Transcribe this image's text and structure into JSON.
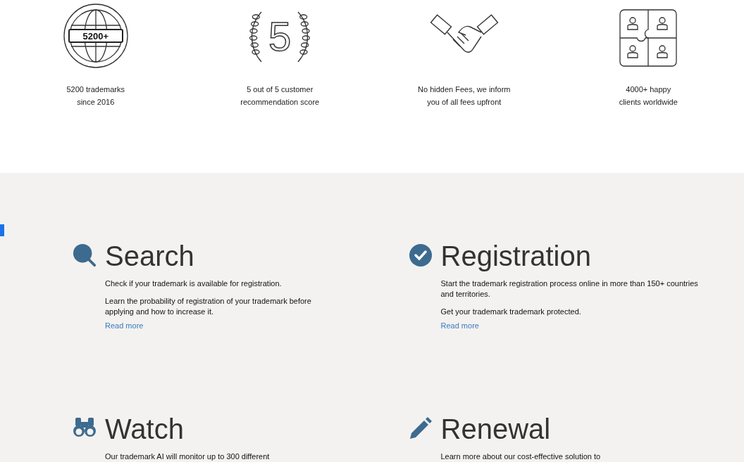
{
  "stats": [
    {
      "badge": "5200+",
      "lines": [
        "5200 trademarks",
        "since 2016"
      ]
    },
    {
      "badge": "5",
      "lines": [
        "5 out of 5 customer",
        "recommendation score"
      ]
    },
    {
      "lines": [
        "No hidden Fees, we inform",
        "you of all fees upfront"
      ]
    },
    {
      "lines": [
        "4000+ happy",
        "clients worldwide"
      ]
    }
  ],
  "services": [
    {
      "title": "Search",
      "paragraphs": [
        "Check if your trademark is available for registration.",
        "Learn the probability of registration of your trademark before applying and how to increase it."
      ],
      "link": "Read more"
    },
    {
      "title": "Registration",
      "paragraphs": [
        "Start the trademark registration process online in more than 150+ countries and territories.",
        "Get your trademark trademark protected."
      ],
      "link": "Read more"
    },
    {
      "title": "Watch",
      "paragraphs": [
        "Our trademark AI will monitor up to 300 different"
      ]
    },
    {
      "title": "Renewal",
      "paragraphs": [
        "Learn more about our cost-effective solution to"
      ]
    }
  ]
}
